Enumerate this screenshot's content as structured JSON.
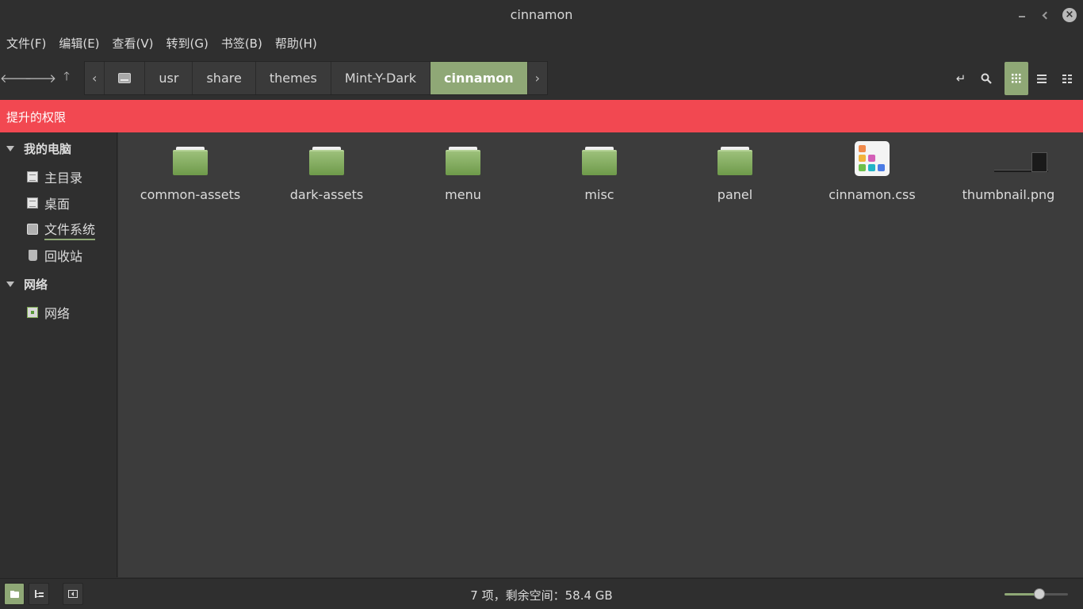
{
  "window": {
    "title": "cinnamon"
  },
  "menu": [
    "文件(F)",
    "编辑(E)",
    "查看(V)",
    "转到(G)",
    "书签(B)",
    "帮助(H)"
  ],
  "path": [
    "usr",
    "share",
    "themes",
    "Mint-Y-Dark",
    "cinnamon"
  ],
  "privilege_banner": "提升的权限",
  "sidebar": {
    "sections": [
      {
        "label": "我的电脑",
        "items": [
          {
            "label": "主目录",
            "icon": "home-folder-icon"
          },
          {
            "label": "桌面",
            "icon": "desktop-icon"
          },
          {
            "label": "文件系统",
            "icon": "drive-icon"
          },
          {
            "label": "回收站",
            "icon": "trash-icon"
          }
        ]
      },
      {
        "label": "网络",
        "items": [
          {
            "label": "网络",
            "icon": "network-icon"
          }
        ]
      }
    ]
  },
  "files": [
    {
      "name": "common-assets",
      "type": "folder"
    },
    {
      "name": "dark-assets",
      "type": "folder"
    },
    {
      "name": "menu",
      "type": "folder"
    },
    {
      "name": "misc",
      "type": "folder"
    },
    {
      "name": "panel",
      "type": "folder"
    },
    {
      "name": "cinnamon.css",
      "type": "css"
    },
    {
      "name": "thumbnail.png",
      "type": "image"
    }
  ],
  "status": {
    "text": "7 项，剩余空间：58.4 GB",
    "zoom_level": 0.55
  },
  "colors": {
    "accent": "#8fa876",
    "privilege": "#f24851"
  }
}
